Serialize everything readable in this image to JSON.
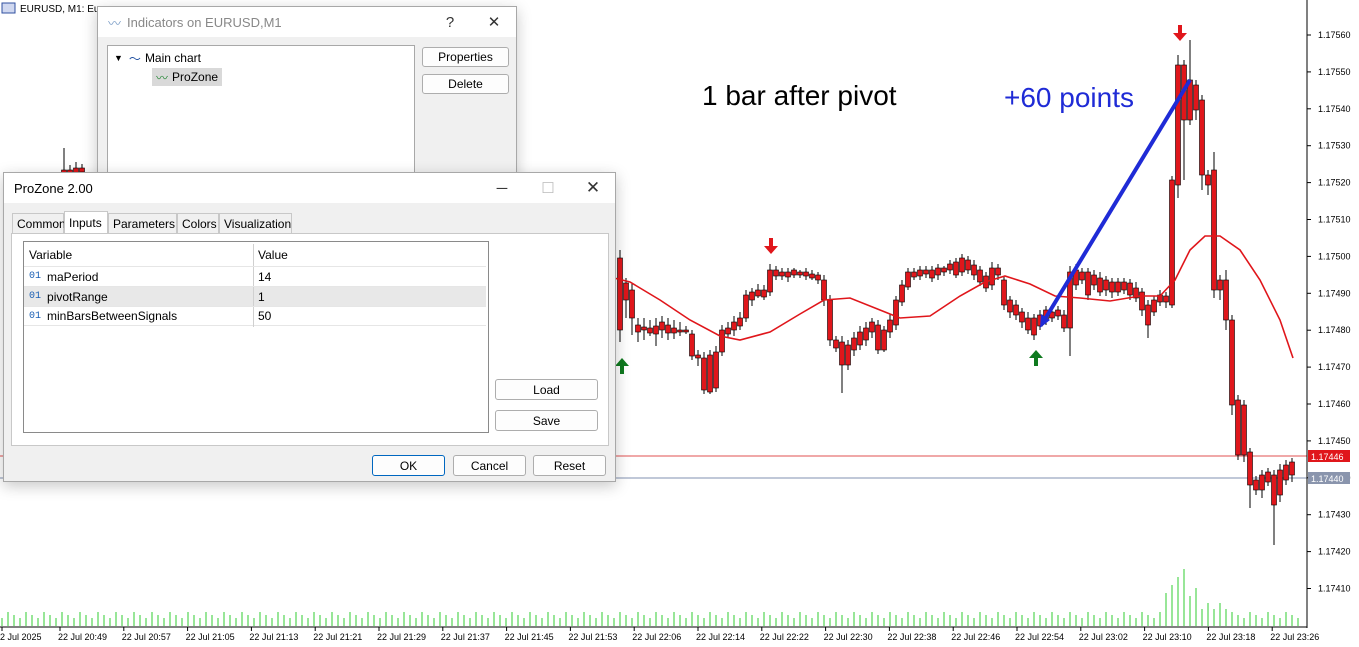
{
  "chart": {
    "header": "EURUSD, M1: Eu",
    "annotation_left": "1 bar after pivot",
    "annotation_right": "+60 points",
    "price_labels": [
      "1.17560",
      "1.17550",
      "1.17540",
      "1.17530",
      "1.17520",
      "1.17510",
      "1.17500",
      "1.17490",
      "1.17480",
      "1.17470",
      "1.17460",
      "1.17450",
      "1.17440",
      "1.17430",
      "1.17420",
      "1.17410"
    ],
    "bid_label": "1.17446",
    "ask_label": "1.17440",
    "time_labels": [
      "2 Jul 2025",
      "22 Jul 20:49",
      "22 Jul 20:57",
      "22 Jul 21:05",
      "22 Jul 21:13",
      "22 Jul 21:21",
      "22 Jul 21:29",
      "22 Jul 21:37",
      "22 Jul 21:45",
      "22 Jul 21:53",
      "22 Jul 22:06",
      "22 Jul 22:14",
      "22 Jul 22:22",
      "22 Jul 22:30",
      "22 Jul 22:38",
      "22 Jul 22:46",
      "22 Jul 22:54",
      "22 Jul 23:02",
      "22 Jul 23:10",
      "22 Jul 23:18",
      "22 Jul 23:26"
    ],
    "colors": {
      "bull": "#3cb043",
      "bear": "#e0161b",
      "ma": "#e0161b",
      "arrow_up": "#0f7a1f",
      "arrow_down": "#e0161b",
      "trend": "#1f2bd6",
      "volume": "#32cd32",
      "bid_line": "#e05050",
      "ask_line": "#8090b0"
    }
  },
  "indicators_dialog": {
    "title": "Indicators on EURUSD,M1",
    "help": "?",
    "close": "✕",
    "tree": {
      "root": "Main chart",
      "child": "ProZone"
    },
    "buttons": {
      "properties": "Properties",
      "delete": "Delete"
    }
  },
  "prozone_dialog": {
    "title": "ProZone 2.00",
    "tabs": [
      "Common",
      "Inputs",
      "Parameters",
      "Colors",
      "Visualization"
    ],
    "active_tab": "Inputs",
    "columns": {
      "variable": "Variable",
      "value": "Value"
    },
    "rows": [
      {
        "type": "01",
        "name": "maPeriod",
        "value": "14"
      },
      {
        "type": "01",
        "name": "pivotRange",
        "value": "1"
      },
      {
        "type": "01",
        "name": "minBarsBetweenSignals",
        "value": "50"
      }
    ],
    "buttons": {
      "load": "Load",
      "save": "Save",
      "ok": "OK",
      "cancel": "Cancel",
      "reset": "Reset"
    }
  }
}
